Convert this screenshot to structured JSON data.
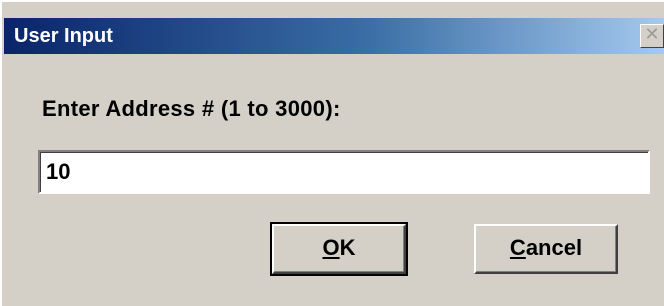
{
  "window": {
    "title": "User Input",
    "close_glyph": "✕"
  },
  "form": {
    "prompt": "Enter Address # (1 to 3000):",
    "value": "10"
  },
  "buttons": {
    "ok": {
      "accel": "O",
      "rest": "K"
    },
    "cancel": {
      "accel": "C",
      "rest": "ancel"
    }
  },
  "colors": {
    "face": "#d4d0c8",
    "titlebar_start": "#0a246a",
    "titlebar_end": "#a6caf0"
  }
}
